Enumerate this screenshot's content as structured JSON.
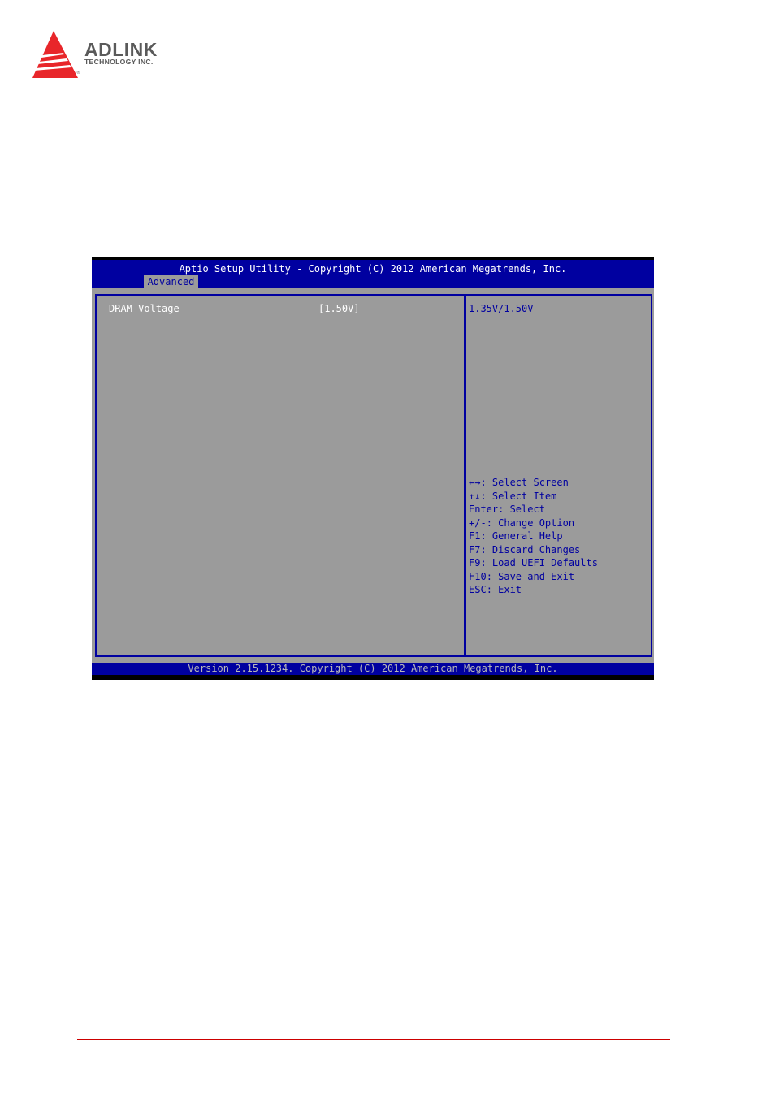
{
  "logo": {
    "brand": "ADLINK",
    "subtitle": "TECHNOLOGY INC.",
    "registered": "®",
    "brand_color": "#e8262a"
  },
  "bios": {
    "title": "Aptio Setup Utility - Copyright (C) 2012 American Megatrends, Inc.",
    "active_tab": "Advanced",
    "settings": [
      {
        "label": "DRAM Voltage",
        "value": "[1.50V]"
      }
    ],
    "help_text": "1.35V/1.50V",
    "keys": [
      {
        "key": "←→",
        "action": ": Select Screen"
      },
      {
        "key": "↑↓",
        "action": ": Select Item"
      },
      {
        "key": "Enter",
        "action": ": Select"
      },
      {
        "key": "+/-",
        "action": ": Change Option"
      },
      {
        "key": "F1",
        "action": ": General Help"
      },
      {
        "key": "F7",
        "action": ": Discard Changes"
      },
      {
        "key": "F9",
        "action": ": Load UEFI Defaults"
      },
      {
        "key": "F10",
        "action": ": Save and Exit"
      },
      {
        "key": "ESC",
        "action": ": Exit"
      }
    ],
    "footer": "Version 2.15.1234. Copyright (C) 2012 American Megatrends, Inc.",
    "colors": {
      "header_blue": "#0000a0",
      "panel_gray": "#9b9b9b",
      "text_white": "#ffffff"
    }
  },
  "page": {
    "rule_color": "#cc0000"
  }
}
